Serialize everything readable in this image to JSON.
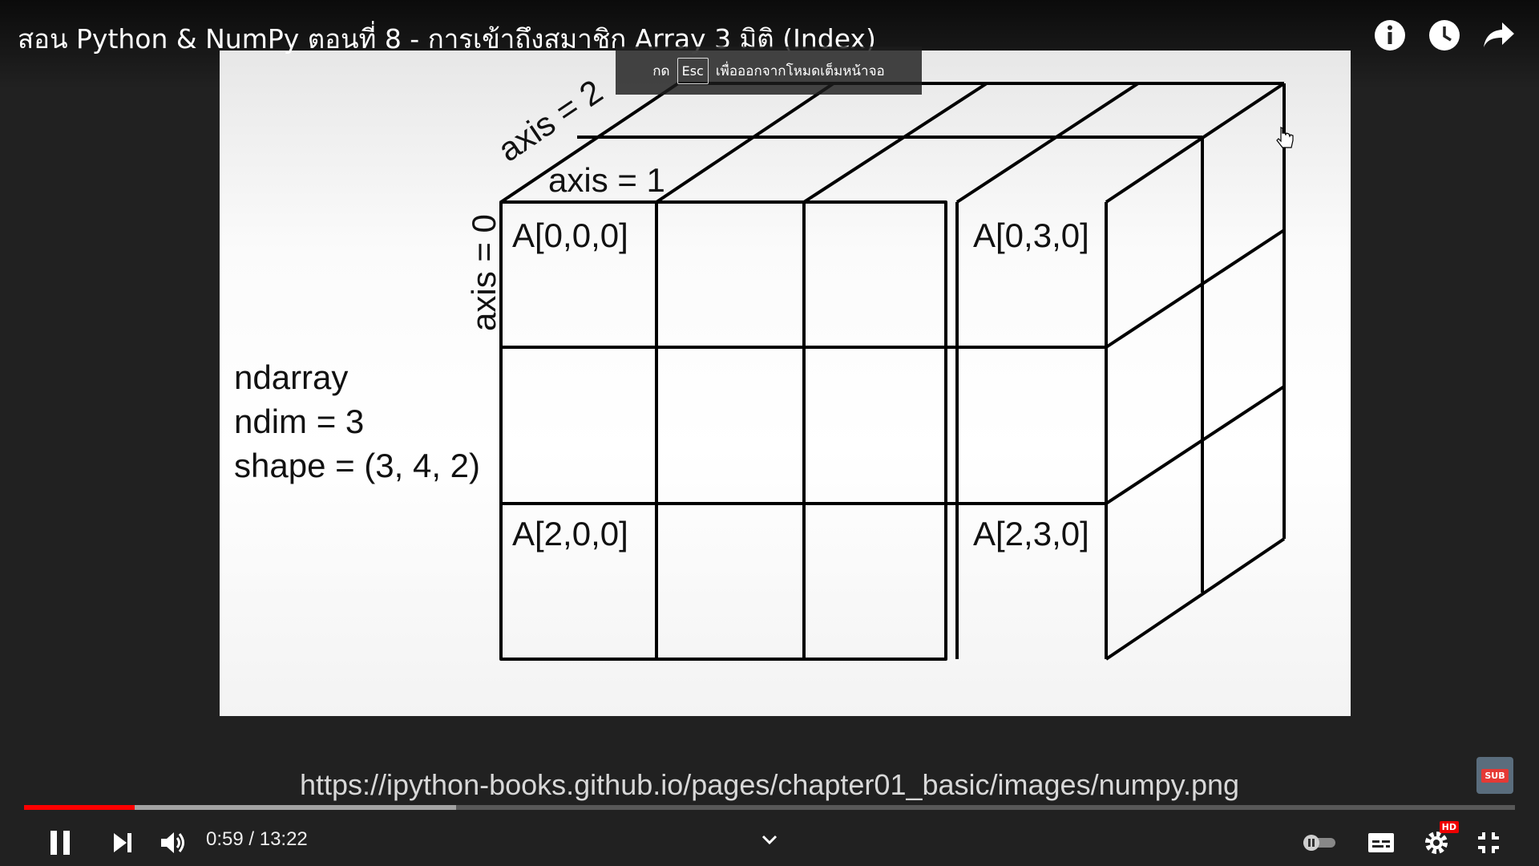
{
  "player": {
    "title": "สอน Python & NumPy ตอนที่ 8 - การเข้าถึงสมาชิก Array 3 มิติ (Index)",
    "esc_toast": {
      "prefix": "กด",
      "key": "Esc",
      "suffix": "เพื่อออกจากโหมดเต็มหน้าจอ"
    },
    "current_time": "0:59",
    "duration": "13:22",
    "time_display": "0:59 / 13:22",
    "progress_played_fraction": 0.074,
    "progress_buffered_fraction": 0.29,
    "quality_badge": "HD",
    "subscribe_badge": "SUB",
    "icons": {
      "info": "info-icon",
      "watch_later": "clock-icon",
      "share": "share-icon",
      "pause": "pause-icon",
      "next": "next-icon",
      "volume": "volume-icon",
      "chevron": "chevron-down-icon",
      "autoplay": "autoplay-toggle-icon",
      "captions": "captions-icon",
      "settings": "gear-icon",
      "exit_fullscreen": "exit-fullscreen-icon"
    },
    "colors": {
      "progress": "#ff0000",
      "background": "#212121"
    }
  },
  "slide": {
    "axis_labels": {
      "axis0": "axis = 0",
      "axis1": "axis = 1",
      "axis2": "axis = 2"
    },
    "cells": {
      "a000": "A[0,0,0]",
      "a030": "A[0,3,0]",
      "a200": "A[2,0,0]",
      "a230": "A[2,3,0]"
    },
    "info_lines": [
      "ndarray",
      "ndim = 3",
      "shape = (3, 4, 2)"
    ],
    "source_url": "https://ipython-books.github.io/pages/chapter01_basic/images/numpy.png"
  }
}
